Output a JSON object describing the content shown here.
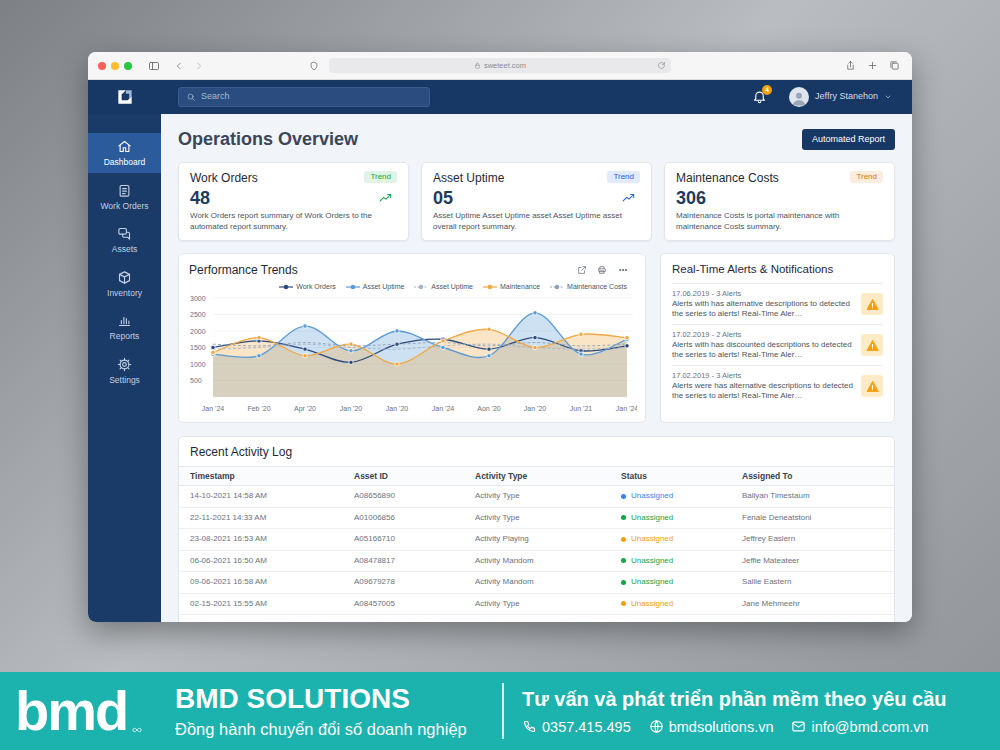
{
  "browser": {
    "address": "sweteet.com"
  },
  "header": {
    "search": {
      "placeholder": "Search"
    },
    "notification_count": "4",
    "user_name": "Jeffry Stanehon"
  },
  "sidebar": {
    "items": [
      {
        "label": "Dashboard",
        "selected": true
      },
      {
        "label": "Work Orders",
        "selected": false
      },
      {
        "label": "Assets",
        "selected": false
      },
      {
        "label": "Inventory",
        "selected": false
      },
      {
        "label": "Reports",
        "selected": false
      },
      {
        "label": "Settings",
        "selected": false
      }
    ]
  },
  "page": {
    "title": "Operations Overview",
    "button": "Automated Report"
  },
  "kpis": [
    {
      "title": "Work Orders",
      "value": "48",
      "badge": "Trend",
      "color": "#16a34a",
      "trend_arrow": true,
      "description": "Work Orders report summary of Work Orders to the automated report summary."
    },
    {
      "title": "Asset Uptime",
      "value": "05",
      "badge": "Trend",
      "color": "#2563eb",
      "trend_arrow": true,
      "description": "Asset Uptime Asset Uptime asset Asset Uptime asset overall report summary."
    },
    {
      "title": "Maintenance Costs",
      "value": "306",
      "badge": "Trend",
      "color": "#d97706",
      "trend_arrow": false,
      "description": "Maintenance Costs is portal maintenance with maintenance Costs summary."
    }
  ],
  "chart": {
    "title": "Performance Trends",
    "y_ticks": [
      "3000",
      "2500",
      "2000",
      "1500",
      "1000",
      "500"
    ],
    "x_ticks": [
      "Jan '24",
      "Feb '20",
      "Apr '20",
      "Jan '20",
      "Jan '20",
      "Jan '24",
      "Aon '20",
      "Jan '20",
      "Jun '21",
      "Jan '24"
    ],
    "series": [
      {
        "name": "Work Orders",
        "kind": "line",
        "color": "#2c4a7e",
        "values": [
          1500,
          1700,
          1450,
          1050,
          1600,
          1750,
          1450,
          1800,
          1400,
          1550
        ]
      },
      {
        "name": "Asset Uptime",
        "kind": "area",
        "color": "#5b9bd5",
        "values": [
          1300,
          1250,
          2150,
          1400,
          2000,
          1500,
          1250,
          2550,
          1300,
          1750
        ]
      },
      {
        "name": "Asset Uptime",
        "kind": "dashed",
        "color": "#a5b4cb",
        "values": [
          1450,
          1500,
          1600,
          1500,
          1450,
          1550,
          1600,
          1500,
          1450,
          1500
        ]
      },
      {
        "name": "Maintenance",
        "kind": "area",
        "color": "#f0a844",
        "values": [
          1350,
          1800,
          1250,
          1600,
          1000,
          1700,
          2050,
          1500,
          1900,
          1800
        ]
      },
      {
        "name": "Maintenance Costs",
        "kind": "dashed",
        "color": "#94a3b8",
        "values": [
          1600,
          1550,
          1650,
          1550,
          1600,
          1650,
          1550,
          1650,
          1550,
          1600
        ]
      }
    ]
  },
  "alerts": {
    "title": "Real-Time Alerts & Notifications",
    "items": [
      {
        "time": "17.06.2019 - 3 Alerts",
        "text": "Alerts with has alternative descriptions to detected the series to alerts! Real-Time Aler…"
      },
      {
        "time": "17.02.2019 - 2 Alerts",
        "text": "Alerts with has discounted descriptions to detected the series to alerts! Real-Time Aler…"
      },
      {
        "time": "17.02.2019 - 3 Alerts",
        "text": "Alerts were has alternative descriptions to detected the series to alerts! Real-Time Aler…"
      }
    ]
  },
  "activity": {
    "title": "Recent Activity Log",
    "columns": [
      "Timestamp",
      "Asset ID",
      "Activity Type",
      "Status",
      "Assigned To"
    ],
    "rows": [
      {
        "cells": [
          "14-10-2021 14:58 AM",
          "A08656890",
          "Activity Type",
          "Unassigned",
          "Bailyan Timestaum"
        ],
        "color": "#3b82f6"
      },
      {
        "cells": [
          "22-11-2021 14:33 AM",
          "A01006856",
          "Activity Type",
          "Unassigned",
          "Fenale Deneatstoni"
        ],
        "color": "#16a34a"
      },
      {
        "cells": [
          "23-08-2021 16:53 AM",
          "A05166710",
          "Activity Playing",
          "Unassigned",
          "Jeffrey Easlern"
        ],
        "color": "#f59e0b"
      },
      {
        "cells": [
          "06-06-2021 16:50 AM",
          "A08478817",
          "Activity Mandom",
          "Unassigned",
          "Jeffie Mateateer"
        ],
        "color": "#16a34a"
      },
      {
        "cells": [
          "09-06-2021 16:58 AM",
          "A09679278",
          "Activity Mandom",
          "Unassigned",
          "Sallie Eastern"
        ],
        "color": "#16a34a"
      },
      {
        "cells": [
          "02-15-2021 15:55 AM",
          "A08457005",
          "Activity Type",
          "Unassigned",
          "Jane Mehmeehr"
        ],
        "color": "#f59e0b"
      }
    ]
  },
  "banner": {
    "logo": "bmd",
    "company": "BMD SOLUTIONS",
    "slogan": "Đồng hành chuyển đổi số doanh nghiệp",
    "tagline": "Tư vấn và phát triển phần mềm theo yêu cầu",
    "contacts": [
      {
        "text": "0357.415.495"
      },
      {
        "text": "bmdsolutions.vn"
      },
      {
        "text": "info@bmd.com.vn"
      }
    ]
  }
}
